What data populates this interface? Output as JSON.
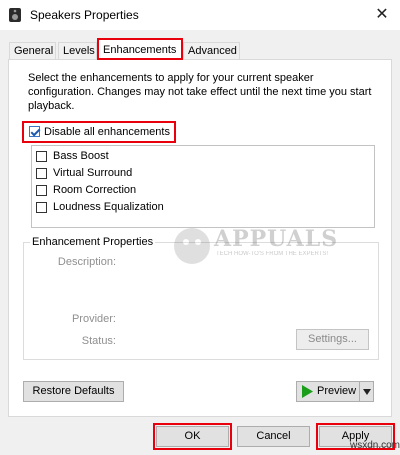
{
  "window": {
    "title": "Speakers Properties",
    "close_glyph": "✕"
  },
  "tabs": [
    {
      "label": "General"
    },
    {
      "label": "Levels"
    },
    {
      "label": "Enhancements"
    },
    {
      "label": "Advanced"
    }
  ],
  "enhancements": {
    "intro": "Select the enhancements to apply for your current speaker configuration. Changes may not take effect until the next time you start playback.",
    "disable_all": {
      "label": "Disable all enhancements",
      "checked": true
    },
    "items": [
      {
        "label": "Bass Boost",
        "checked": false
      },
      {
        "label": "Virtual Surround",
        "checked": false
      },
      {
        "label": "Room Correction",
        "checked": false
      },
      {
        "label": "Loudness Equalization",
        "checked": false
      }
    ]
  },
  "properties": {
    "group_title": "Enhancement Properties",
    "description_label": "Description:",
    "provider_label": "Provider:",
    "status_label": "Status:",
    "settings_button": "Settings..."
  },
  "watermark": {
    "brand": "APPUALS",
    "tagline": "TECH HOW-TO'S FROM THE EXPERTS!"
  },
  "actions": {
    "restore_defaults": "Restore Defaults",
    "preview": "Preview"
  },
  "dialog_buttons": {
    "ok": "OK",
    "cancel": "Cancel",
    "apply": "Apply"
  },
  "site": "wsxdn.com",
  "colors": {
    "highlight": "#e8000d",
    "check": "#1e5bb0",
    "play": "#1a9d1a"
  }
}
